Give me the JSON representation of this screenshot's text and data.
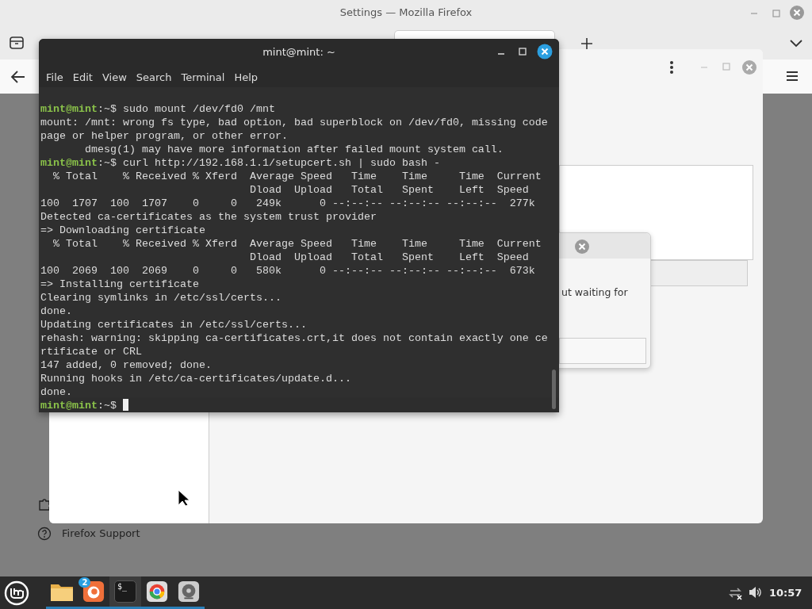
{
  "firefox": {
    "title": "Settings — Mozilla Firefox",
    "support_link": "Firefox Support"
  },
  "dialog": {
    "partial_text": "ut waiting for"
  },
  "terminal": {
    "title": "mint@mint: ~",
    "menu": [
      "File",
      "Edit",
      "View",
      "Search",
      "Terminal",
      "Help"
    ],
    "lines": [
      {
        "kind": "prompt",
        "user": "mint@mint",
        "path": ":~$",
        "command": " sudo mount /dev/fd0 /mnt"
      },
      {
        "kind": "output",
        "text": "mount: /mnt: wrong fs type, bad option, bad superblock on /dev/fd0, missing code"
      },
      {
        "kind": "output",
        "text": "page or helper program, or other error."
      },
      {
        "kind": "output",
        "text": "       dmesg(1) may have more information after failed mount system call."
      },
      {
        "kind": "prompt",
        "user": "mint@mint",
        "path": ":~$",
        "command": " curl http://192.168.1.1/setupcert.sh | sudo bash -"
      },
      {
        "kind": "output",
        "text": "  % Total    % Received % Xferd  Average Speed   Time    Time     Time  Current"
      },
      {
        "kind": "output",
        "text": "                                 Dload  Upload   Total   Spent    Left  Speed"
      },
      {
        "kind": "output",
        "text": "100  1707  100  1707    0     0   249k      0 --:--:-- --:--:-- --:--:--  277k"
      },
      {
        "kind": "output",
        "text": "Detected ca-certificates as the system trust provider"
      },
      {
        "kind": "output",
        "text": "=> Downloading certificate"
      },
      {
        "kind": "output",
        "text": "  % Total    % Received % Xferd  Average Speed   Time    Time     Time  Current"
      },
      {
        "kind": "output",
        "text": "                                 Dload  Upload   Total   Spent    Left  Speed"
      },
      {
        "kind": "output",
        "text": "100  2069  100  2069    0     0   580k      0 --:--:-- --:--:-- --:--:--  673k"
      },
      {
        "kind": "output",
        "text": "=> Installing certificate"
      },
      {
        "kind": "output",
        "text": "Clearing symlinks in /etc/ssl/certs..."
      },
      {
        "kind": "output",
        "text": "done."
      },
      {
        "kind": "output",
        "text": "Updating certificates in /etc/ssl/certs..."
      },
      {
        "kind": "output",
        "text": "rehash: warning: skipping ca-certificates.crt,it does not contain exactly one ce"
      },
      {
        "kind": "output",
        "text": "rtificate or CRL"
      },
      {
        "kind": "output",
        "text": "147 added, 0 removed; done."
      },
      {
        "kind": "output",
        "text": "Running hooks in /etc/ca-certificates/update.d..."
      },
      {
        "kind": "output",
        "text": "done."
      },
      {
        "kind": "prompt",
        "user": "mint@mint",
        "path": ":~$",
        "cursor": true
      }
    ]
  },
  "taskbar": {
    "apps": [
      {
        "kind": "folder",
        "active": false
      },
      {
        "kind": "firefox",
        "badge": "2",
        "active": false
      },
      {
        "kind": "terminal",
        "glyph": "$_",
        "active": true
      },
      {
        "kind": "chrome",
        "active": false
      },
      {
        "kind": "disk",
        "active": false
      }
    ],
    "clock": "10:57"
  }
}
